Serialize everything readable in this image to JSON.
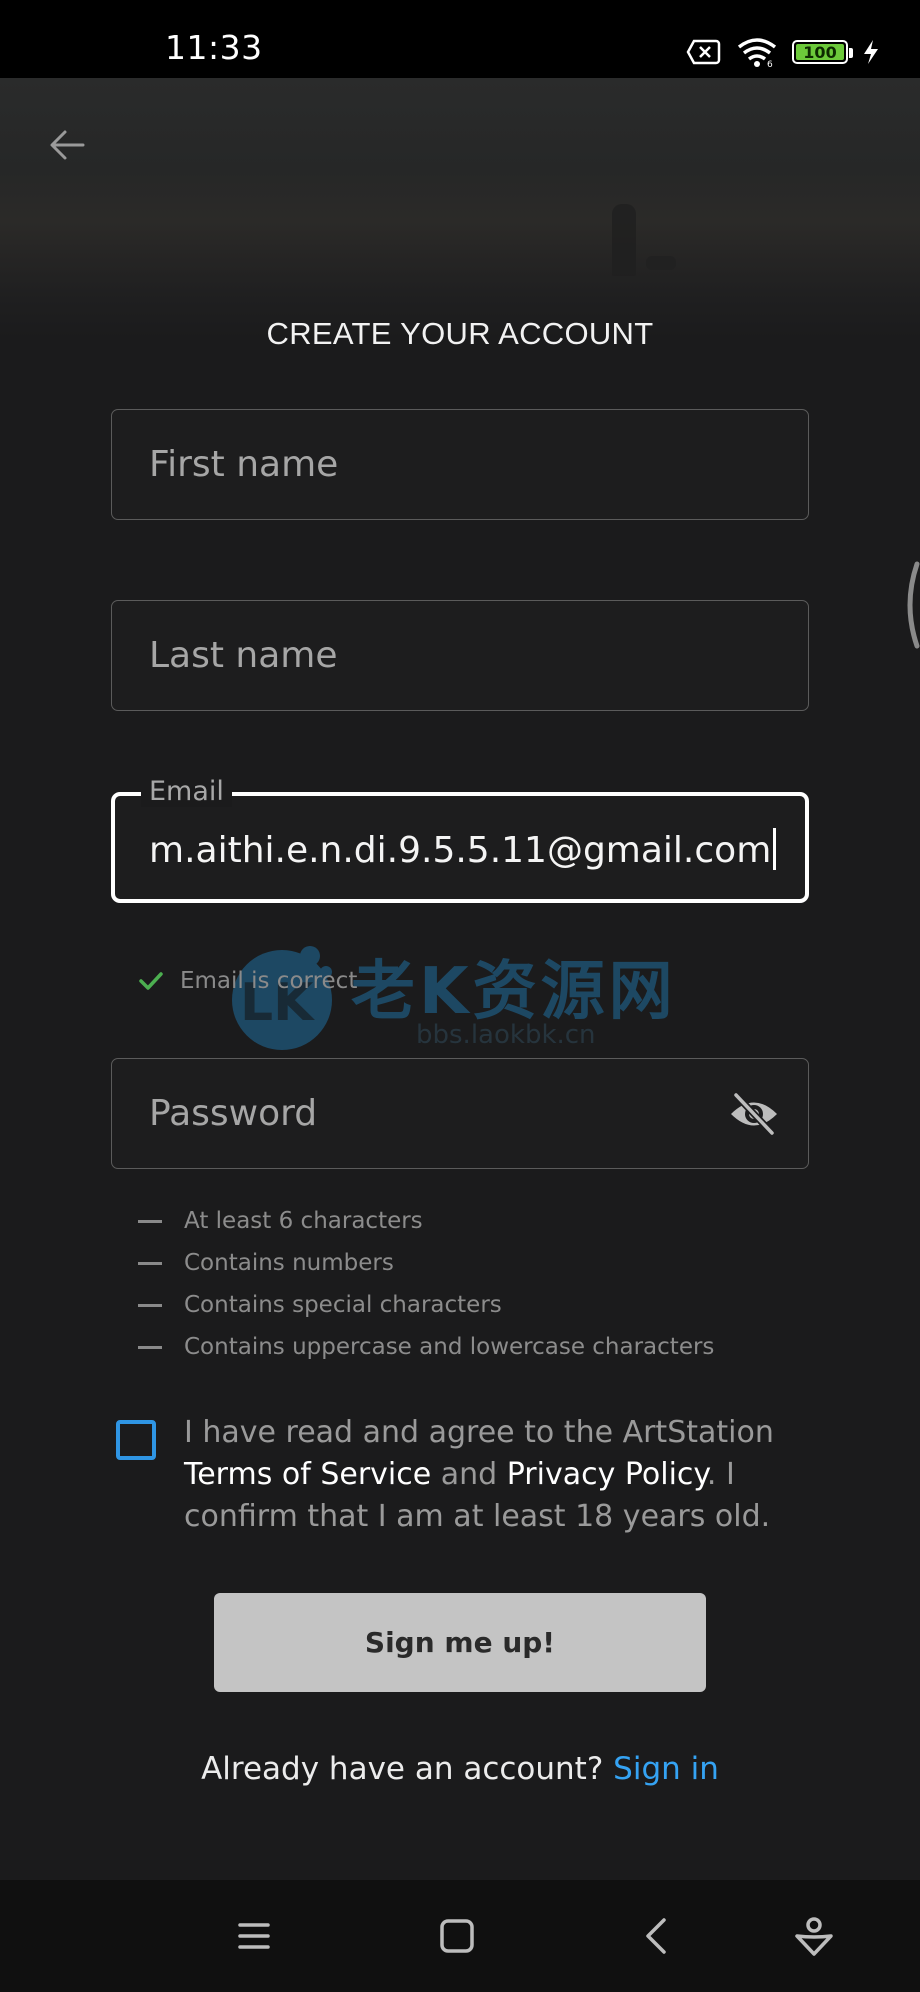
{
  "status_bar": {
    "time": "11:33",
    "battery_level": "100",
    "icons": [
      "sim-off-icon",
      "wifi-icon",
      "battery-icon",
      "charging-bolt-icon"
    ]
  },
  "header": {
    "back_icon": "arrow-left-icon",
    "title": "CREATE YOUR ACCOUNT"
  },
  "form": {
    "first_name": {
      "placeholder": "First name",
      "value": ""
    },
    "last_name": {
      "placeholder": "Last name",
      "value": ""
    },
    "email": {
      "label": "Email",
      "value": "m.aithi.e.n.di.9.5.5.11@gmail.com",
      "validation": "Email is correct"
    },
    "password": {
      "placeholder": "Password",
      "value": "",
      "toggle_icon": "eye-off-icon"
    },
    "password_rules": [
      "At least 6 characters",
      "Contains numbers",
      "Contains special characters",
      "Contains uppercase and lowercase characters"
    ],
    "agreement": {
      "checked": false,
      "prefix": "I have read and agree to the ArtStation ",
      "terms_link": "Terms of Service",
      "and": " and ",
      "privacy_link": "Privacy Policy",
      "suffix": ". I confirm that I am at least 18 years old."
    },
    "submit_label": "Sign me up!"
  },
  "footer": {
    "prompt": "Already have an account? ",
    "signin_link": "Sign in"
  },
  "watermark": {
    "title": "老K资源网",
    "url": "bbs.laokbk.cn"
  },
  "nav_bar": {
    "icons": [
      "menu-icon",
      "home-square-icon",
      "back-chevron-icon",
      "assistant-icon"
    ]
  },
  "colors": {
    "background": "#1b1b1c",
    "accent_blue": "#35a3f3",
    "checkbox_blue": "#2f95e4",
    "valid_green": "#4caf50",
    "button_gray": "#c4c4c4"
  }
}
